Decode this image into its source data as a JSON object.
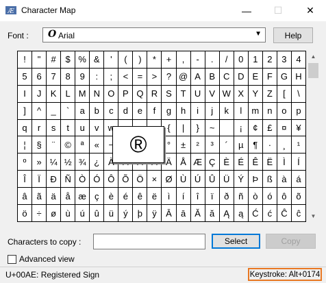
{
  "window": {
    "title": "Character Map",
    "controls": {
      "minimize": "—",
      "maximize": "☐",
      "close": "✕"
    }
  },
  "font": {
    "label": "Font :",
    "icon": "opentype-font-icon",
    "icon_glyph": "O",
    "value": "Arial",
    "help_label": "Help"
  },
  "grid": {
    "rows": [
      [
        "!",
        "\"",
        "#",
        "$",
        "%",
        "&",
        "'",
        "(",
        ")",
        "*",
        "+",
        ",",
        "-",
        ".",
        "/",
        "0",
        "1",
        "2",
        "3",
        "4"
      ],
      [
        "5",
        "6",
        "7",
        "8",
        "9",
        ":",
        ";",
        "<",
        "=",
        ">",
        "?",
        "@",
        "A",
        "B",
        "C",
        "D",
        "E",
        "F",
        "G",
        "H"
      ],
      [
        "I",
        "J",
        "K",
        "L",
        "M",
        "N",
        "O",
        "P",
        "Q",
        "R",
        "S",
        "T",
        "U",
        "V",
        "W",
        "X",
        "Y",
        "Z",
        "[",
        "\\"
      ],
      [
        "]",
        "^",
        "_",
        "`",
        "a",
        "b",
        "c",
        "d",
        "e",
        "f",
        "g",
        "h",
        "i",
        "j",
        "k",
        "l",
        "m",
        "n",
        "o",
        "p"
      ],
      [
        "q",
        "r",
        "s",
        "t",
        "u",
        "v",
        "w",
        "x",
        "y",
        "z",
        "{",
        "|",
        "}",
        "~",
        " ",
        "¡",
        "¢",
        "£",
        "¤",
        "¥"
      ],
      [
        "¦",
        "§",
        "¨",
        "©",
        "ª",
        "«",
        "¬",
        "­",
        "®",
        "¯",
        "°",
        "±",
        "²",
        "³",
        "´",
        "µ",
        "¶",
        "·",
        "¸",
        "¹"
      ],
      [
        "º",
        "»",
        "¼",
        "½",
        "¾",
        "¿",
        "À",
        "Á",
        "Â",
        "Ã",
        "Ä",
        "Å",
        "Æ",
        "Ç",
        "È",
        "É",
        "Ê",
        "Ë",
        "Ì",
        "Í"
      ],
      [
        "Î",
        "Ï",
        "Ð",
        "Ñ",
        "Ò",
        "Ó",
        "Ô",
        "Õ",
        "Ö",
        "×",
        "Ø",
        "Ù",
        "Ú",
        "Û",
        "Ü",
        "Ý",
        "Þ",
        "ß",
        "à",
        "á"
      ],
      [
        "â",
        "ã",
        "ä",
        "å",
        "æ",
        "ç",
        "è",
        "é",
        "ê",
        "ë",
        "ì",
        "í",
        "î",
        "ï",
        "ð",
        "ñ",
        "ò",
        "ó",
        "ô",
        "õ"
      ],
      [
        "ö",
        "÷",
        "ø",
        "ù",
        "ú",
        "û",
        "ü",
        "ý",
        "þ",
        "ÿ",
        "Ā",
        "ā",
        "Ă",
        "ă",
        "Ą",
        "ą",
        "Ć",
        "ć",
        "Ĉ",
        "ĉ"
      ]
    ],
    "magnified_char": "®"
  },
  "copy": {
    "label": "Characters to copy :",
    "value": "",
    "select_label": "Select",
    "copy_label": "Copy"
  },
  "advanced": {
    "label": "Advanced view",
    "checked": false
  },
  "status": {
    "char_info": "U+00AE: Registered Sign",
    "keystroke": "Keystroke: Alt+0174"
  },
  "colors": {
    "highlight": "#e87722",
    "accent": "#0078d7"
  }
}
